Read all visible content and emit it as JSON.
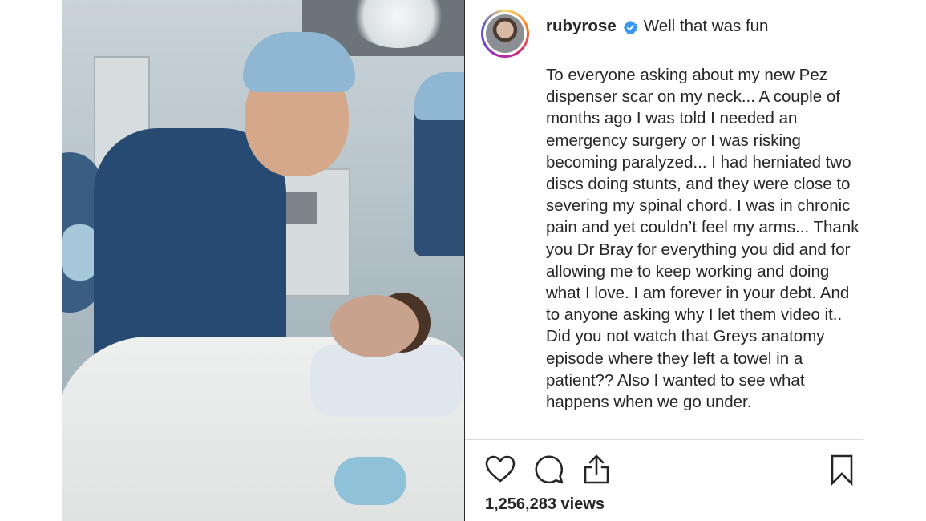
{
  "post": {
    "username": "rubyrose",
    "verified": true,
    "caption_title": "Well that was fun",
    "caption_body": "To everyone asking about my new Pez dispenser scar on my neck... A couple of months ago I was told I needed an emergency surgery or I was risking becoming paralyzed... I had herniated two discs doing stunts, and they were close to severing my spinal chord. I was in chronic pain and yet couldn’t feel my arms... Thank you Dr Bray for everything you did and for allowing me to keep working and doing what I love. I am forever in your debt. And to anyone asking why I let them video it.. Did you not watch that Greys anatomy episode where they left a towel in a patient?? Also I wanted to see what happens when we go under.",
    "views": "1,256,283 views"
  },
  "icons": {
    "like": "heart-icon",
    "comment": "comment-bubble-icon",
    "share": "share-upload-icon",
    "save": "bookmark-icon",
    "verified": "verified-badge-icon"
  },
  "colors": {
    "text": "#262626",
    "verified_blue": "#3897f0",
    "divider": "#dbdbdb"
  }
}
